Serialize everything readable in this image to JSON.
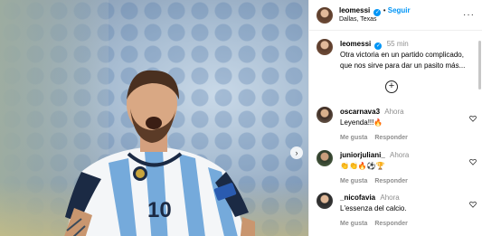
{
  "post": {
    "username": "leomessi",
    "follow_label": "Seguir",
    "location": "Dallas, Texas",
    "more_label": "···"
  },
  "caption": {
    "username": "leomessi",
    "time": "55 min",
    "text": "Otra victoria en un partido complicado, que nos sirve para dar un pasito más..."
  },
  "add_icon": "plus-circle-icon",
  "comments": [
    {
      "username": "oscarnava3",
      "time": "Ahora",
      "text": "Leyenda!!!🔥",
      "like": "Me gusta",
      "reply": "Responder"
    },
    {
      "username": "juniorjuliani_",
      "time": "Ahora",
      "text": "👏👏🔥⚽🏆",
      "like": "Me gusta",
      "reply": "Responder"
    },
    {
      "username": "_nicofavia",
      "time": "Ahora",
      "text": "L'essenza del calcio.",
      "like": "Me gusta",
      "reply": "Responder"
    }
  ],
  "colors": {
    "accent": "#0095f6",
    "muted": "#8e8e8e",
    "jersey_blue": "#75aadb"
  }
}
